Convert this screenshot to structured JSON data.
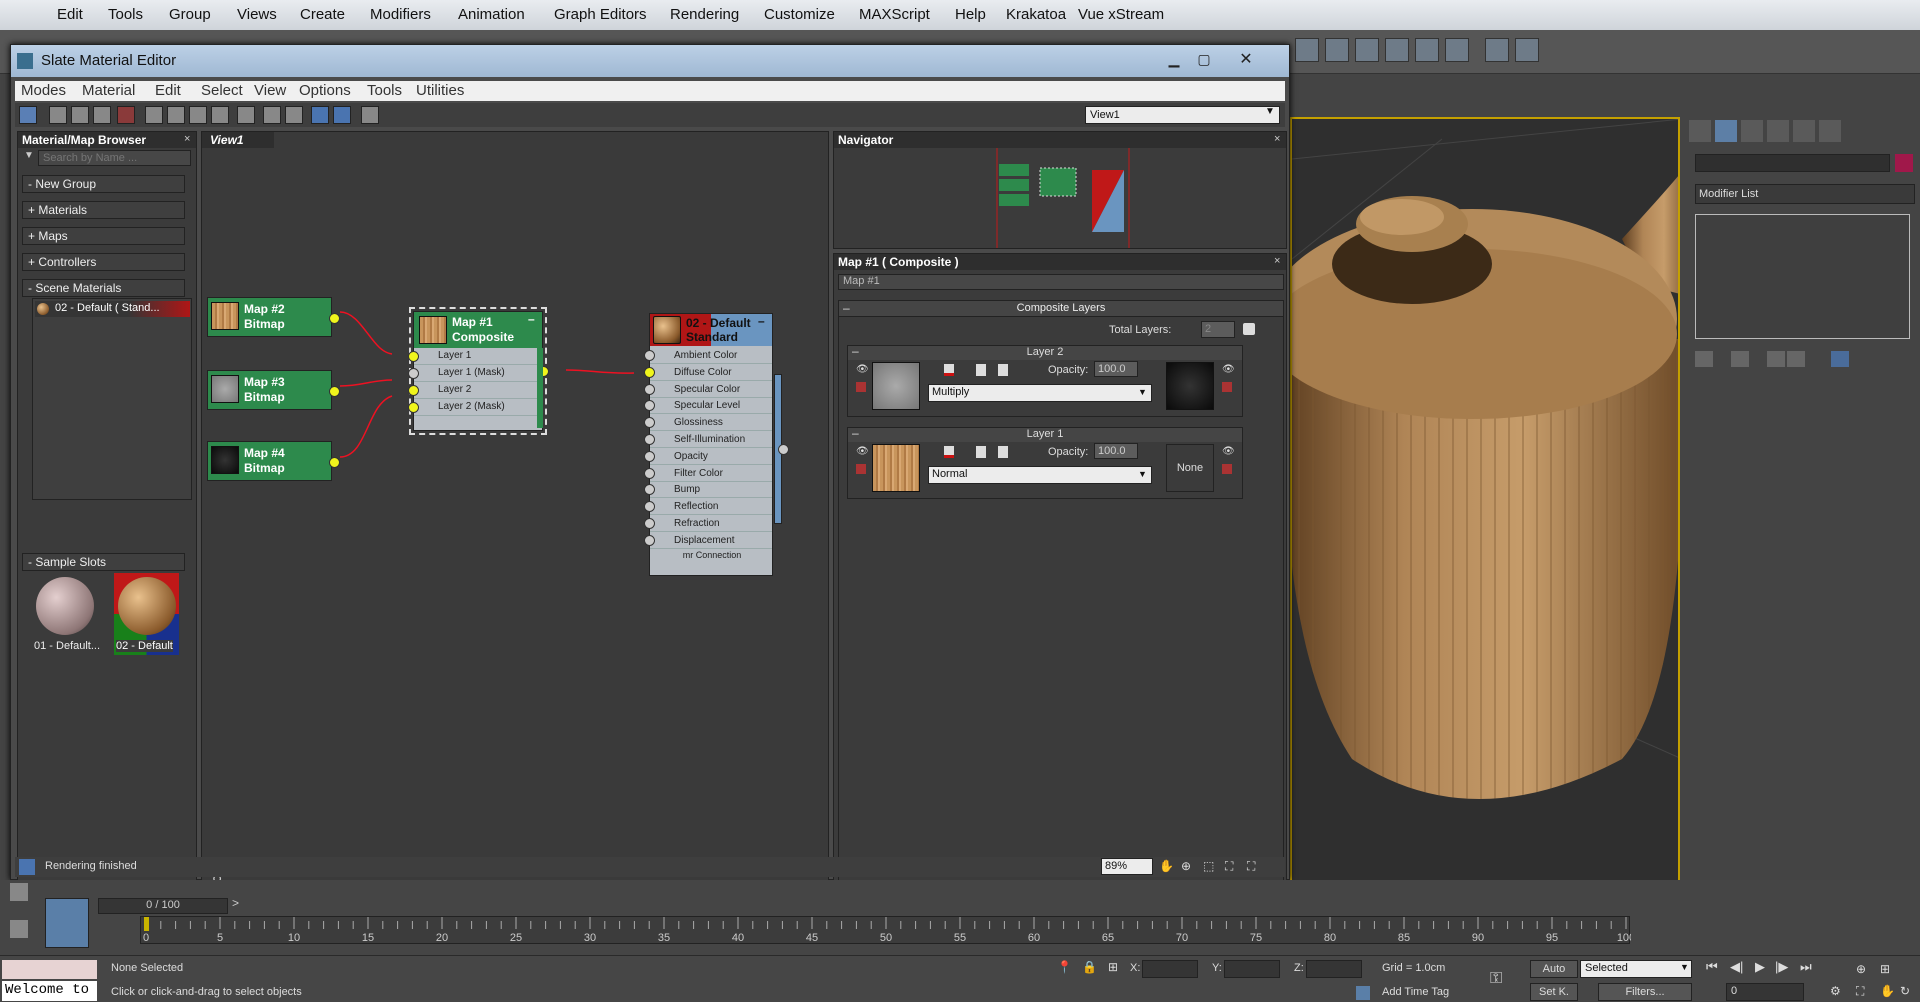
{
  "app": {
    "menu": [
      "Edit",
      "Tools",
      "Group",
      "Views",
      "Create",
      "Modifiers",
      "Animation",
      "Graph Editors",
      "Rendering",
      "Customize",
      "MAXScript",
      "Help",
      "Krakatoa",
      "Vue xStream"
    ]
  },
  "slate": {
    "title": "Slate Material Editor",
    "menu": [
      "Modes",
      "Material",
      "Edit",
      "Select",
      "View",
      "Options",
      "Tools",
      "Utilities"
    ],
    "view_dropdown": "View1",
    "status": "Rendering finished",
    "zoom": "89%"
  },
  "browser": {
    "title": "Material/Map Browser",
    "search_placeholder": "Search by Name ...",
    "groups": [
      "- New Group",
      "+ Materials",
      "+ Maps",
      "+ Controllers",
      "- Scene Materials"
    ],
    "scene_material": "02 - Default  ( Stand...",
    "sample_slots_label": "- Sample Slots",
    "slots": [
      "01 - Default...",
      "02 - Default"
    ]
  },
  "view": {
    "tab": "View1",
    "nodes": {
      "map2": {
        "name": "Map #2",
        "type": "Bitmap"
      },
      "map3": {
        "name": "Map #3",
        "type": "Bitmap"
      },
      "map4": {
        "name": "Map #4",
        "type": "Bitmap"
      },
      "composite": {
        "name": "Map #1",
        "type": "Composite",
        "slots": [
          "Layer 1",
          "Layer 1 (Mask)",
          "Layer 2",
          "Layer 2 (Mask)"
        ]
      },
      "material": {
        "name": "02 - Default",
        "type": "Standard",
        "slots": [
          "Ambient Color",
          "Diffuse Color",
          "Specular Color",
          "Specular Level",
          "Glossiness",
          "Self-Illumination",
          "Opacity",
          "Filter Color",
          "Bump",
          "Reflection",
          "Refraction",
          "Displacement"
        ],
        "footer": "mr Connection"
      }
    }
  },
  "navigator": {
    "title": "Navigator"
  },
  "props": {
    "title": "Map #1  ( Composite )",
    "name_field": "Map #1",
    "rollout": "Composite Layers",
    "total_layers_label": "Total Layers:",
    "total_layers": "2",
    "layer2": {
      "title": "Layer 2",
      "opacity_label": "Opacity:",
      "opacity": "100.0",
      "blend": "Multiply"
    },
    "layer1": {
      "title": "Layer 1",
      "opacity_label": "Opacity:",
      "opacity": "100.0",
      "blend": "Normal",
      "mask": "None"
    }
  },
  "cmdpanel": {
    "modifier_list": "Modifier List"
  },
  "timeline": {
    "frame": "0 / 100",
    "ticks": [
      "0",
      "5",
      "10",
      "15",
      "20",
      "25",
      "30",
      "35",
      "40",
      "45",
      "50",
      "55",
      "60",
      "65",
      "70",
      "75",
      "80",
      "85",
      "90",
      "95",
      "100"
    ]
  },
  "statusbar": {
    "selection": "None Selected",
    "prompt": "Click or click-and-drag to select objects",
    "welcome": "Welcome to",
    "x_label": "X:",
    "y_label": "Y:",
    "z_label": "Z:",
    "grid": "Grid = 1.0cm",
    "add_time_tag": "Add Time Tag",
    "auto": "Auto",
    "selected": "Selected",
    "set_key": "Set K.",
    "filters": "Filters...",
    "frame_field": "0"
  }
}
